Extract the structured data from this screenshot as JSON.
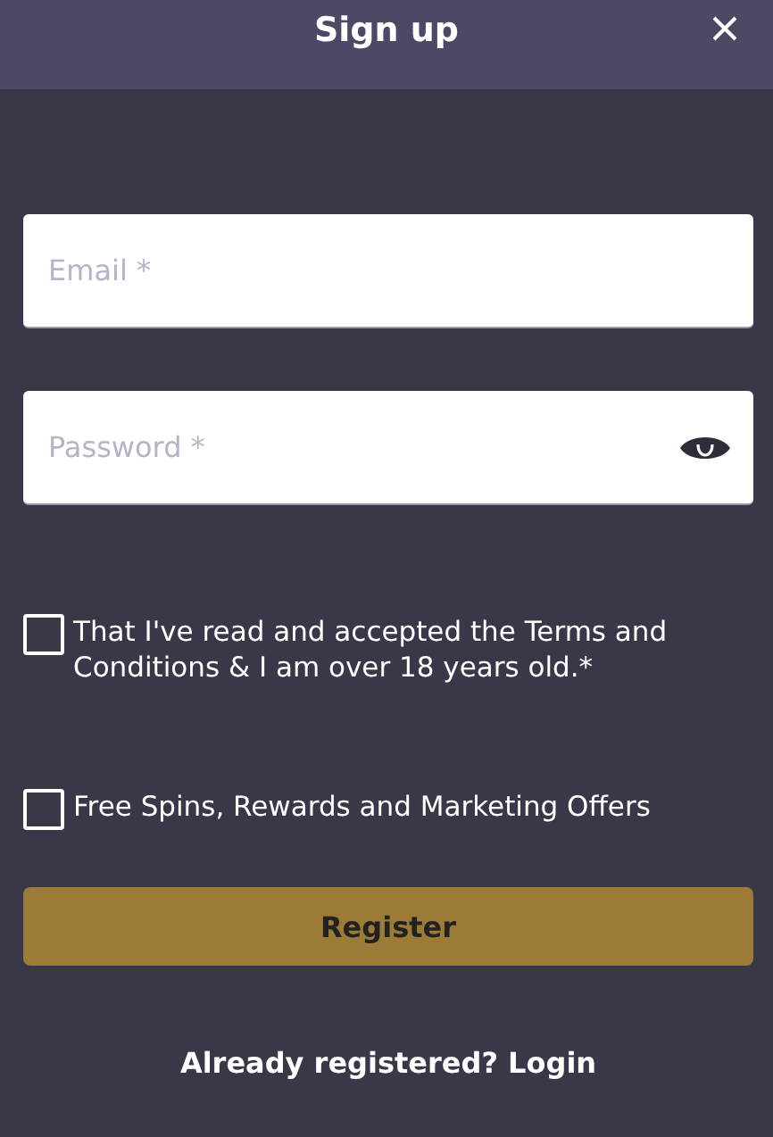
{
  "dialog": {
    "title": "Sign up"
  },
  "fields": [
    {
      "kind": "text",
      "placeholder": "Email *"
    },
    {
      "kind": "password",
      "placeholder": "Password *"
    }
  ],
  "consents": [
    {
      "label": "That I've read and accepted the Terms and Conditions & I am over 18 years old.*",
      "checked": false
    },
    {
      "label": "Free Spins, Rewards and Marketing Offers",
      "checked": false
    }
  ],
  "submit": {
    "label": "Register"
  },
  "login_link": {
    "label": "Already registered? Login"
  }
}
